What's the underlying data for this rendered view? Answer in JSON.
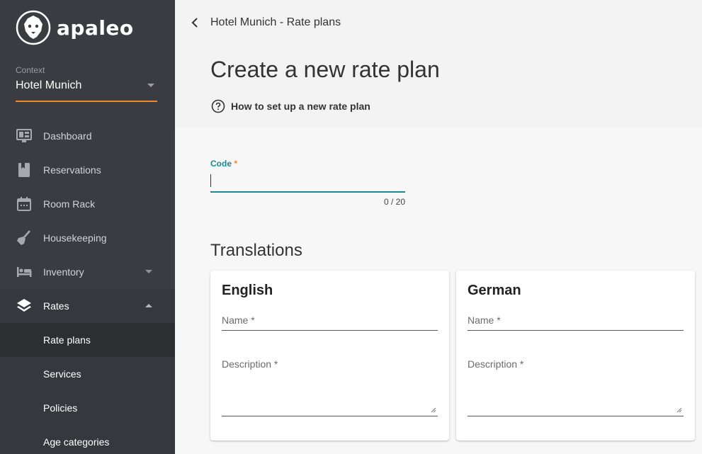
{
  "brand": {
    "name": "apaleo",
    "accent": "#f08a24",
    "teal": "#1a8a91"
  },
  "context": {
    "label": "Context",
    "value": "Hotel Munich"
  },
  "nav": {
    "items": [
      {
        "label": "Dashboard",
        "icon": "dashboard-icon"
      },
      {
        "label": "Reservations",
        "icon": "book-icon"
      },
      {
        "label": "Room Rack",
        "icon": "calendar-icon"
      },
      {
        "label": "Housekeeping",
        "icon": "broom-icon"
      },
      {
        "label": "Inventory",
        "icon": "bed-icon"
      },
      {
        "label": "Rates",
        "icon": "layers-icon"
      }
    ],
    "sub": [
      "Rate plans",
      "Services",
      "Policies",
      "Age categories"
    ]
  },
  "header": {
    "breadcrumb": "Hotel Munich - Rate plans",
    "title": "Create a new rate plan",
    "help": "How to set up a new rate plan"
  },
  "form": {
    "code_label": "Code",
    "code_required": "*",
    "code_value": "",
    "code_counter": "0 / 20"
  },
  "translations": {
    "title": "Translations",
    "cards": [
      {
        "title": "English",
        "name_label": "Name *",
        "description_label": "Description *"
      },
      {
        "title": "German",
        "name_label": "Name *",
        "description_label": "Description *"
      }
    ]
  }
}
